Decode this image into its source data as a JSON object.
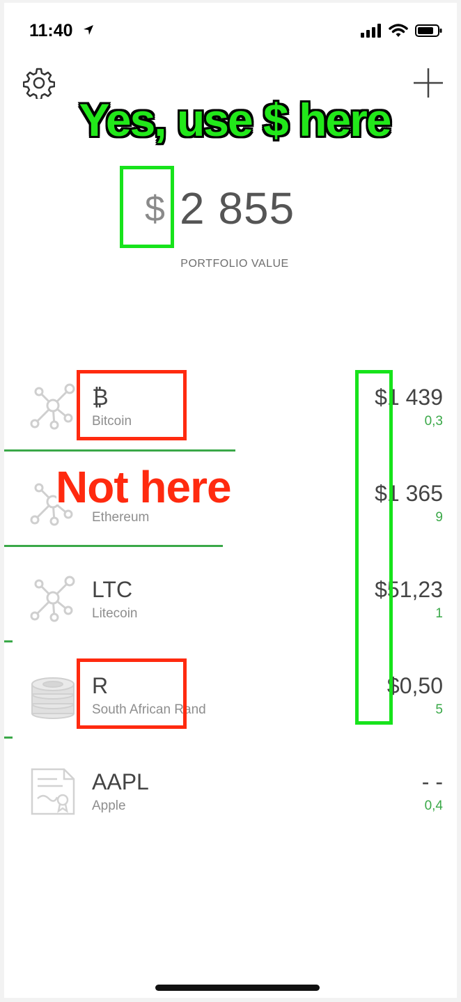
{
  "status": {
    "time": "11:40"
  },
  "header": {
    "settings_icon": "gear-icon",
    "add_icon": "plus-icon"
  },
  "annotations": {
    "yes_label": "Yes, use $ here",
    "no_label": "Not here"
  },
  "portfolio": {
    "currency": "$",
    "amount": "2 855",
    "label": "PORTFOLIO VALUE"
  },
  "assets": [
    {
      "symbol": "₿",
      "name": "Bitcoin",
      "value": "$1 439",
      "quantity": "0,3",
      "icon": "network-node-icon"
    },
    {
      "symbol": "",
      "name": "Ethereum",
      "value": "$1 365",
      "quantity": "9",
      "icon": "network-node-icon"
    },
    {
      "symbol": "LTC",
      "name": "Litecoin",
      "value": "$51,23",
      "quantity": "1",
      "icon": "network-node-icon"
    },
    {
      "symbol": "R",
      "name": "South African Rand",
      "value": "$0,50",
      "quantity": "5",
      "icon": "coin-stack-icon"
    },
    {
      "symbol": "AAPL",
      "name": "Apple",
      "value": "- -",
      "quantity": "0,4",
      "icon": "certificate-icon"
    }
  ],
  "colors": {
    "annotation_green": "#17e31b",
    "annotation_red": "#ff2a0f",
    "quantity_green": "#3aa848"
  }
}
